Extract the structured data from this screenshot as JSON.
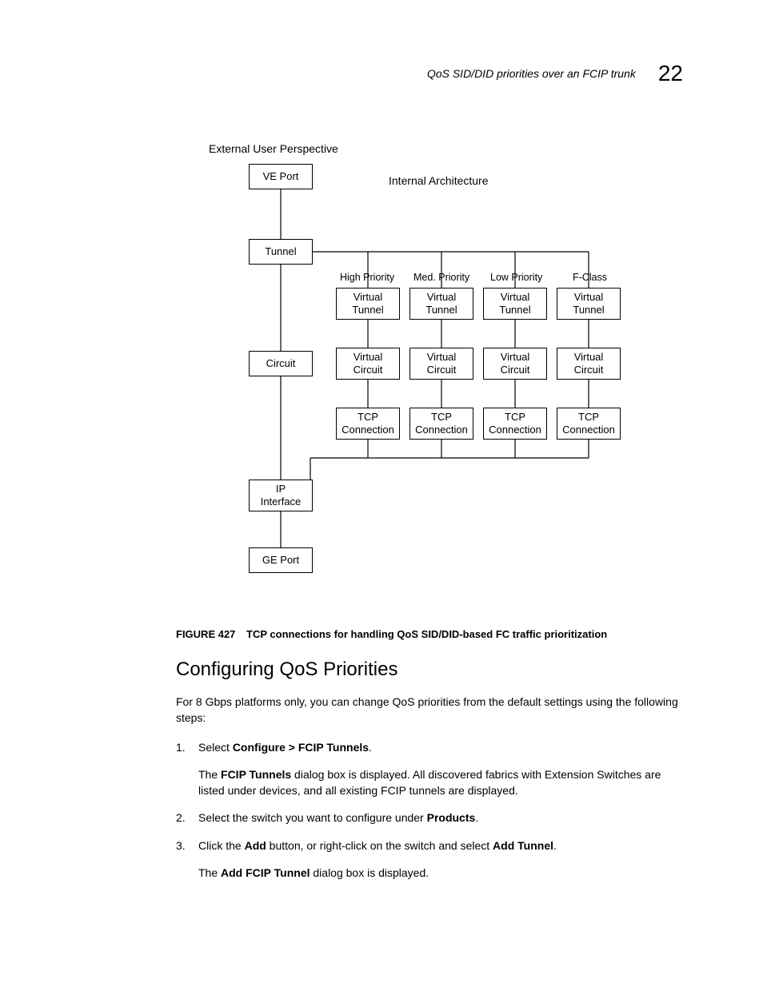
{
  "header": {
    "title": "QoS SID/DID priorities over an FCIP trunk",
    "chapter": "22"
  },
  "diagram": {
    "outerTitle": "External User Perspective",
    "innerTitle": "Internal Architecture",
    "leftCol": {
      "vePort": "VE Port",
      "tunnel": "Tunnel",
      "circuit": "Circuit",
      "ipInterface": "IP\nInterface",
      "gePort": "GE Port"
    },
    "priorityLabels": {
      "high": "High Priority",
      "med": "Med. Priority",
      "low": "Low Priority",
      "fclass": "F-Class"
    },
    "cells": {
      "vTunnel": "Virtual\nTunnel",
      "vCircuit": "Virtual\nCircuit",
      "tcp": "TCP\nConnection"
    }
  },
  "figure": {
    "label": "FIGURE 427",
    "caption": "TCP connections for handling QoS SID/DID-based FC traffic prioritization"
  },
  "section": {
    "heading": "Configuring QoS Priorities",
    "intro": "For 8 Gbps platforms only, you can change QoS priorities from the default settings using the following steps:",
    "step1_prefix": "Select ",
    "step1_bold": "Configure > FCIP Tunnels",
    "step1_suffix": ".",
    "step1_desc_pre": "The ",
    "step1_desc_bold": "FCIP Tunnels",
    "step1_desc_post": " dialog box is displayed. All discovered fabrics with Extension Switches are listed under devices, and all existing FCIP tunnels are displayed.",
    "step2_pre": "Select the switch you want to configure under ",
    "step2_bold": "Products",
    "step2_suffix": ".",
    "step3_pre": "Click the ",
    "step3_bold1": "Add",
    "step3_mid": " button, or right-click on the switch and select ",
    "step3_bold2": "Add Tunnel",
    "step3_suffix": ".",
    "step3_desc_pre": "The ",
    "step3_desc_bold": "Add FCIP Tunnel",
    "step3_desc_post": " dialog box is displayed."
  }
}
